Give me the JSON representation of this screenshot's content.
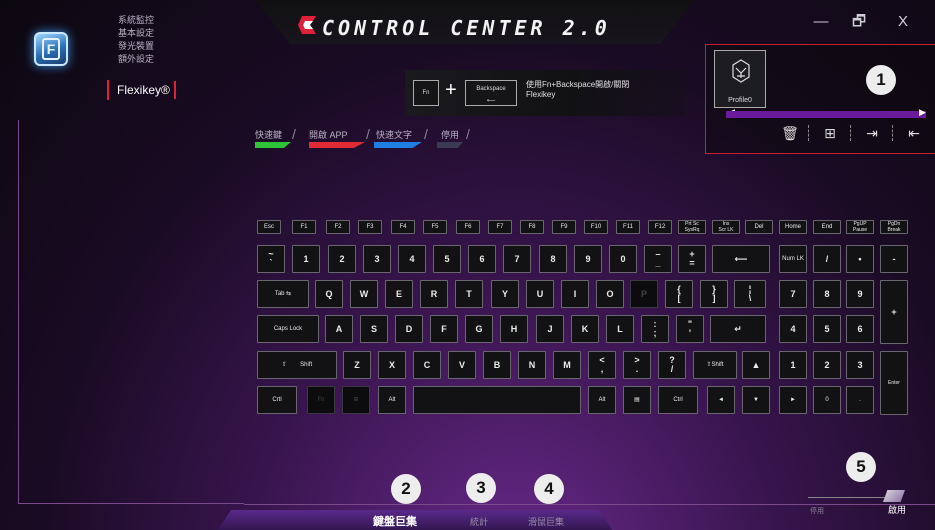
{
  "header": {
    "title": "CONTROL CENTER 2.0",
    "window_controls": {
      "minimize": "—",
      "restore": "🗗",
      "close": "X"
    }
  },
  "menu": {
    "items": [
      "系統監控",
      "基本設定",
      "發光裝置",
      "額外設定"
    ],
    "active": "Flexikey®"
  },
  "hint": {
    "key1": "Fn",
    "plus": "+",
    "key2": "Backspace",
    "line1": "使用Fn+Backspace開啟/關閉",
    "line2": "Flexikey"
  },
  "profile": {
    "name": "Profile0",
    "badge": "1"
  },
  "tabs": [
    {
      "label": "快速鍵",
      "color": "#2fc33a"
    },
    {
      "label": "開啟 APP",
      "color": "#e02a35"
    },
    {
      "label": "快速文字",
      "color": "#1f7fe0"
    },
    {
      "label": "停用",
      "color": "#3a3a55"
    }
  ],
  "keyboard": {
    "row_fn": [
      "Esc",
      "F1",
      "F2",
      "F3",
      "F4",
      "F5",
      "F6",
      "F7",
      "F8",
      "F9",
      "F10",
      "F11",
      "F12",
      "Prt Sc\nSysRq",
      "Ins\nScr LK",
      "Del",
      "Home",
      "End",
      "PgUP\nPause",
      "PgDn\nBreak"
    ],
    "row_num": [
      "~\n`",
      "1",
      "2",
      "3",
      "4",
      "5",
      "6",
      "7",
      "8",
      "9",
      "0",
      "–\n_",
      "+\n=",
      "⟵",
      "Num LK",
      "/",
      "•",
      "-"
    ],
    "row_q": [
      "Tab ⇆",
      "Q",
      "W",
      "E",
      "R",
      "T",
      "Y",
      "U",
      "I",
      "O",
      "P",
      "{\n[",
      "}\n]",
      "¦\n\\",
      "7",
      "8",
      "9",
      "+"
    ],
    "row_a": [
      "Caps Lock",
      "A",
      "S",
      "D",
      "F",
      "G",
      "H",
      "J",
      "K",
      "L",
      ":\n;",
      "\"\n'",
      "↵",
      "4",
      "5",
      "6"
    ],
    "row_z": [
      "⇧        Shift",
      "Z",
      "X",
      "C",
      "V",
      "B",
      "N",
      "M",
      "<\n,",
      ">\n.",
      "?\n/",
      "⇧Shift",
      "▲",
      "1",
      "2",
      "3",
      "Enter"
    ],
    "row_ctrl": [
      "Crtl",
      "Fn",
      "⊞",
      "Alt",
      "",
      "Alt",
      "▤",
      "Ctrl",
      "◄",
      "▼",
      "►",
      "0",
      "."
    ]
  },
  "bottom": {
    "tabs": [
      {
        "label": "鍵盤巨集",
        "badge": "2"
      },
      {
        "label": "統計",
        "badge": "3"
      },
      {
        "label": "滑鼠巨集",
        "badge": "4"
      }
    ],
    "toggle_off": "停用",
    "toggle_on": "啟用",
    "toggle_badge": "5"
  }
}
